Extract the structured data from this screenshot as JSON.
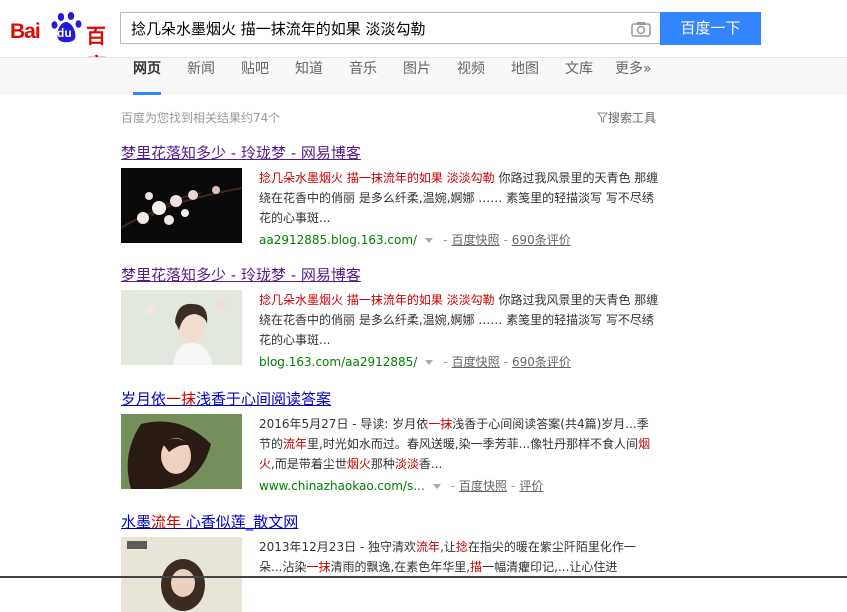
{
  "logo": {
    "bai": "Bai",
    "du": "du",
    "cn": "百度"
  },
  "search": {
    "query": "捻几朵水墨烟火 描一抹流年的如果 淡淡勾勒",
    "button": "百度一下"
  },
  "nav": [
    "网页",
    "新闻",
    "贴吧",
    "知道",
    "音乐",
    "图片",
    "视频",
    "地图",
    "文库",
    "更多»"
  ],
  "stats": "百度为您找到相关结果约74个",
  "tools": "搜索工具",
  "results": [
    {
      "title": "梦里花落知多少 - 玲珑梦 - 网易博客",
      "abstract_hl": "捻几朵水墨烟火 描一抹流年的如果 淡淡勾勒",
      "abstract_rest": " 你路过我风景里的天青色 那缠绕在花香中的俏丽 是多么纤柔,温婉,婀娜 …… 素笺里的轻描淡写 写不尽绣花的心事斑...",
      "url": "aa2912885.blog.163.com/",
      "snapshot": "百度快照",
      "comments": "690条评价"
    },
    {
      "title": "梦里花落知多少 - 玲珑梦 - 网易博客",
      "abstract_hl": "捻几朵水墨烟火 描一抹流年的如果 淡淡勾勒",
      "abstract_rest": " 你路过我风景里的天青色 那缠绕在花香中的俏丽 是多么纤柔,温婉,婀娜 …… 素笺里的轻描淡写 写不尽绣花的心事斑...",
      "url": "blog.163.com/aa2912885/",
      "snapshot": "百度快照",
      "comments": "690条评价"
    },
    {
      "title_a": "岁月依",
      "title_hl": "一抹",
      "title_b": "浅香于心间阅读答案",
      "abs": {
        "p1": "2016年5月27日 - 导读: 岁月依",
        "h1": "一抹",
        "p2": "浅香于心间阅读答案(共4篇)岁月...季节的",
        "h2": "流年",
        "p3": "里,时光如水而过。春风送暖,染一季芳菲...像牡丹那样不食人间",
        "h3": "烟火",
        "p4": ",而是带着尘世",
        "h4": "烟火",
        "p5": "那种",
        "h5": "淡淡",
        "p6": "香..."
      },
      "url": "www.chinazhaokao.com/s...",
      "snapshot": "百度快照",
      "comments": "评价"
    },
    {
      "title_a": "水墨",
      "title_hl": "流年",
      "title_b": " 心香似莲_散文网",
      "abs": {
        "p1": "2013年12月23日 - 独守清欢",
        "h1": "流年",
        "p2": ",让",
        "h2": "捻",
        "p3": "在指尖的暖在紫尘阡陌里化作一朵...沾染",
        "h3": "一抹",
        "p4": "清雨的飘逸,在素色年华里,",
        "h4": "描",
        "p5": "一幅清癯印记,...让心住进"
      }
    }
  ],
  "colors": {
    "brand_red": "#e10601",
    "brand_blue": "#2319dc",
    "button_blue": "#3385ff",
    "link": "#0000cc",
    "highlight": "#cc0000",
    "url_green": "#008000"
  }
}
